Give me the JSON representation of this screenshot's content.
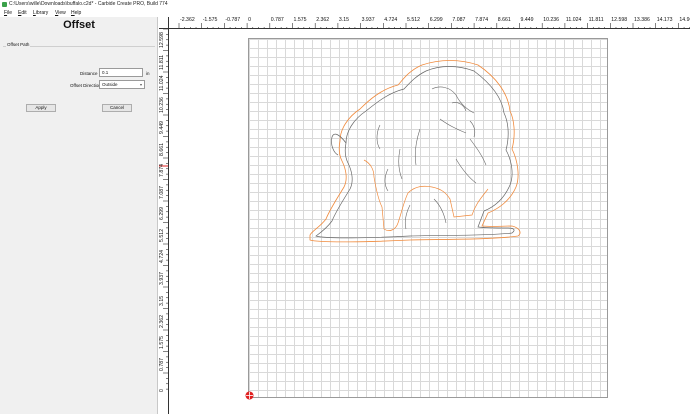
{
  "window": {
    "title": "C:\\Users\\wille\\Downloads\\buffalo.c2d* - Carbide Create PRO, Build 774",
    "icon": "carbide-create-icon"
  },
  "menu": {
    "items": [
      "File",
      "Edit",
      "Library",
      "View",
      "Help"
    ]
  },
  "panel": {
    "title": "Offset",
    "group_label": "Offset Path",
    "distance_label": "Distance",
    "distance_value": "0.1",
    "unit": "in",
    "direction_label": "Offset Direction",
    "direction_value": "Outside",
    "apply_label": "Apply",
    "cancel_label": "Cancel"
  },
  "rulers": {
    "horizontal": [
      "-2.362",
      "-1.575",
      "-0.787",
      "0",
      "0.787",
      "1.575",
      "2.362",
      "3.15",
      "3.937",
      "4.724",
      "5.512",
      "6.299",
      "7.087",
      "7.874",
      "8.661",
      "9.449",
      "10.236",
      "11.024",
      "11.811",
      "12.598",
      "13.386",
      "14.173",
      "14.961"
    ],
    "vertical": [
      "12.598",
      "11.811",
      "11.024",
      "10.236",
      "9.449",
      "8.661",
      "7.874",
      "7.087",
      "6.299",
      "5.512",
      "4.724",
      "3.937",
      "3.15",
      "2.362",
      "1.575",
      "0.787",
      "0"
    ]
  },
  "colors": {
    "original_path": "#666666",
    "offset_path": "#f08a3c",
    "grid": "#d9d9d9",
    "cursor_marker": "#e02020"
  }
}
